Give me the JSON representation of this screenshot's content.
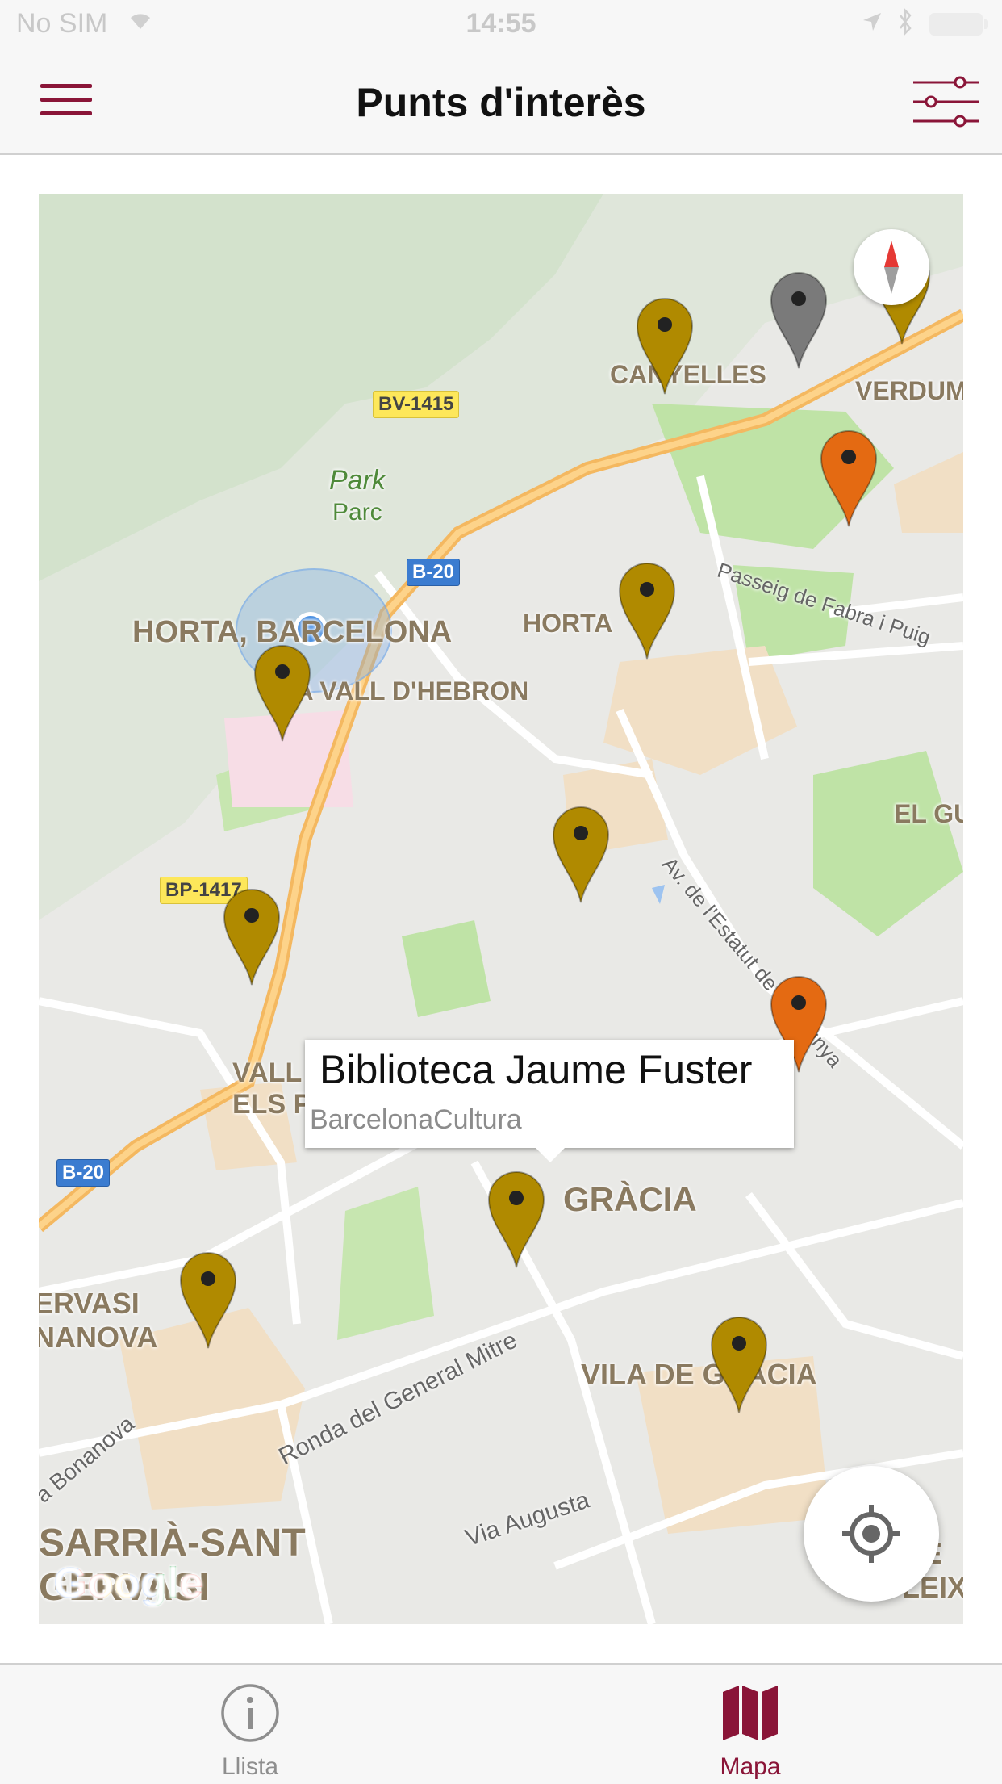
{
  "status_bar": {
    "carrier": "No SIM",
    "time": "14:55",
    "icons": [
      "wifi-icon",
      "location-arrow-icon",
      "bluetooth-icon",
      "battery-icon"
    ]
  },
  "nav": {
    "title": "Punts d'interès",
    "menu_icon": "hamburger-menu-icon",
    "filter_icon": "filter-sliders-icon"
  },
  "colors": {
    "accent": "#8a1538",
    "pin_gold": "#b08a00",
    "pin_orange": "#e46a12",
    "pin_gray": "#7a7a7a"
  },
  "map": {
    "areas": [
      "HORTA, BARCELONA",
      "LA VALL D'HEBRON",
      "HORTA",
      "CANYELLES",
      "VERDUM",
      "EL GU",
      "VALL ELS P",
      "GRÀCIA",
      "VILA DE GRÀCIA",
      "ERVASI NANOVA",
      "SARRIÀ-SANT GERVASI",
      "RE LEIX"
    ],
    "parks": [
      "Park",
      "Parc"
    ],
    "streets": [
      "Passeig de Fabra i Puig",
      "Av. de l'Estatut de Catalunya",
      "Ronda del General Mitre",
      "Via Augusta",
      "a Bonanova"
    ],
    "road_shields": [
      "BV-1415",
      "B-20",
      "BP-1417",
      "B-20"
    ],
    "info_window": {
      "title": "Biblioteca Jaume Fuster",
      "subtitle": "BarcelonaCultura"
    },
    "pins": [
      {
        "name": "pin-canyelles",
        "color": "gold"
      },
      {
        "name": "pin-gray-northeast",
        "color": "gray"
      },
      {
        "name": "pin-northeast-edge",
        "color": "gold"
      },
      {
        "name": "pin-verdum-orange",
        "color": "orange"
      },
      {
        "name": "pin-horta",
        "color": "gold"
      },
      {
        "name": "pin-horta-barcelona",
        "color": "gold"
      },
      {
        "name": "pin-center",
        "color": "gold"
      },
      {
        "name": "pin-bp1417",
        "color": "gold"
      },
      {
        "name": "pin-east-orange",
        "color": "orange"
      },
      {
        "name": "pin-biblioteca-jaume-fuster",
        "color": "gold"
      },
      {
        "name": "pin-bonanova",
        "color": "gold"
      },
      {
        "name": "pin-vila-de-gracia",
        "color": "gold"
      }
    ],
    "controls": {
      "compass_icon": "compass-icon",
      "mylocation_icon": "crosshair-location-icon"
    },
    "attribution": "Google"
  },
  "tabs": [
    {
      "label": "Llista",
      "icon": "info-circle-icon",
      "active": false
    },
    {
      "label": "Mapa",
      "icon": "folded-map-icon",
      "active": true
    }
  ]
}
